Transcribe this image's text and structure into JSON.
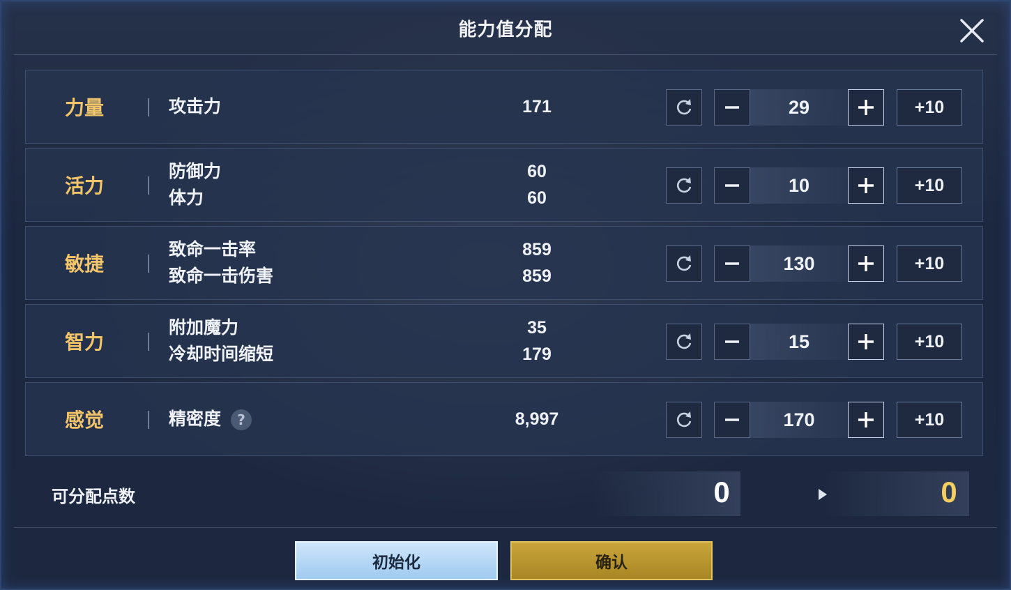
{
  "dialog": {
    "title": "能力值分配"
  },
  "stats": [
    {
      "name": "力量",
      "attributes": [
        {
          "label": "攻击力",
          "value": "171"
        }
      ],
      "points": "29",
      "plus10_label": "+10"
    },
    {
      "name": "活力",
      "attributes": [
        {
          "label": "防御力",
          "value": "60"
        },
        {
          "label": "体力",
          "value": "60"
        }
      ],
      "points": "10",
      "plus10_label": "+10"
    },
    {
      "name": "敏捷",
      "attributes": [
        {
          "label": "致命一击率",
          "value": "859"
        },
        {
          "label": "致命一击伤害",
          "value": "859"
        }
      ],
      "points": "130",
      "plus10_label": "+10"
    },
    {
      "name": "智力",
      "attributes": [
        {
          "label": "附加魔力",
          "value": "35"
        },
        {
          "label": "冷却时间缩短",
          "value": "179"
        }
      ],
      "points": "15",
      "plus10_label": "+10"
    },
    {
      "name": "感觉",
      "attributes": [
        {
          "label": "精密度",
          "value": "8,997"
        }
      ],
      "help_icon": "?",
      "points": "170",
      "plus10_label": "+10"
    }
  ],
  "distributable": {
    "label": "可分配点数",
    "current": "0",
    "after": "0"
  },
  "buttons": {
    "reset_all": "初始化",
    "confirm": "确认"
  },
  "icons": {
    "close": "close-icon",
    "reset": "refresh-icon",
    "minus": "minus-icon",
    "plus": "plus-icon",
    "arrow": "arrow-right-icon"
  },
  "colors": {
    "stat_name": "#f2c56a",
    "reset_all_button": "#b5d8f5",
    "confirm_button": "#b8952e",
    "points_after": "#f5cf62"
  }
}
